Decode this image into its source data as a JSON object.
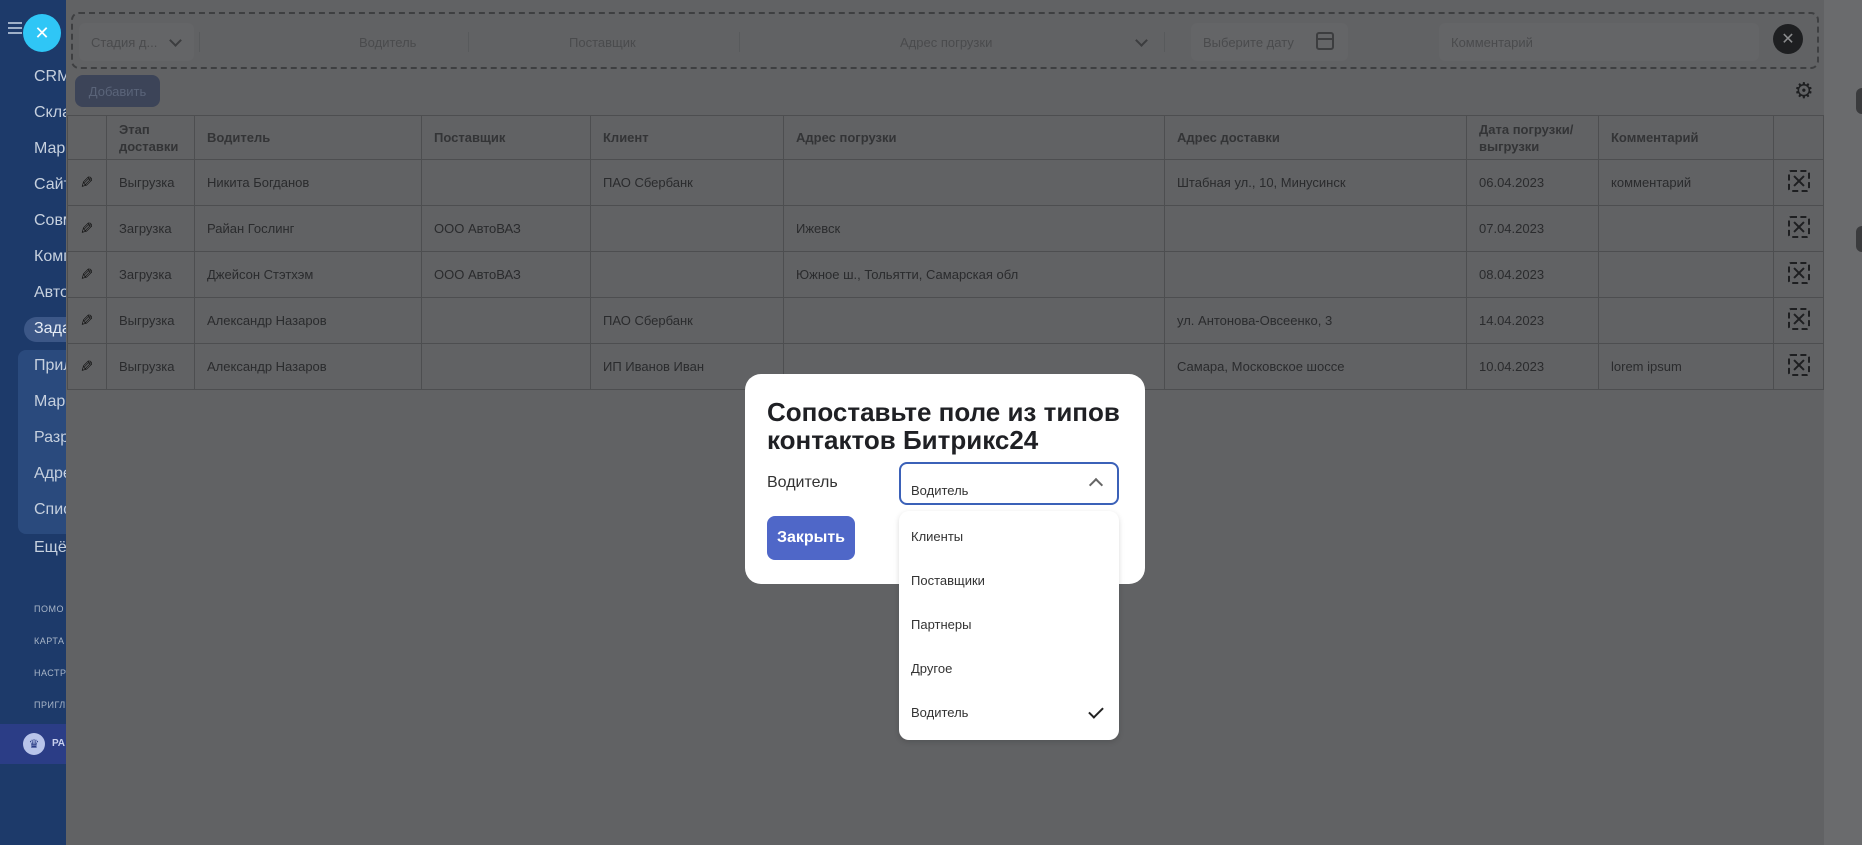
{
  "sidebar": {
    "menu": [
      "CRM",
      "Скла",
      "Мар",
      "Сайт",
      "Совм",
      "Комп",
      "Авто",
      "Зада",
      "Прил",
      "Мар",
      "Разр",
      "Адре",
      "Спис",
      "Ещё"
    ],
    "small": [
      "ПОМО",
      "КАРТА",
      "НАСТР",
      "ПРИГЛ"
    ],
    "crown_text": "РА"
  },
  "filters": {
    "stage": "Стадия д...",
    "driver": "Водитель",
    "supplier": "Поставщик",
    "load_address": "Адрес погрузки",
    "date": "Выберите дату",
    "comment": "Комментарий"
  },
  "toolbar": {
    "add_label": "Добавить"
  },
  "table": {
    "headers": [
      "Этап доставки",
      "Водитель",
      "Поставщик",
      "Клиент",
      "Адрес погрузки",
      "Адрес доставки",
      "Дата погрузки/ выгрузки",
      "Комментарий"
    ],
    "rows": [
      [
        "Выгрузка",
        "Никита Богданов",
        "",
        "ПАО Сбербанк",
        "",
        "Штабная ул., 10, Минусинск",
        "06.04.2023",
        "комментарий"
      ],
      [
        "Загрузка",
        "Райан Гослинг",
        "ООО АвтоВАЗ",
        "",
        "Ижевск",
        "",
        "07.04.2023",
        ""
      ],
      [
        "Загрузка",
        "Джейсон Стэтхэм",
        "ООО АвтоВАЗ",
        "",
        "Южное ш., Тольятти, Самарская обл",
        "",
        "08.04.2023",
        ""
      ],
      [
        "Выгрузка",
        "Александр Назаров",
        "",
        "ПАО Сбербанк",
        "",
        "ул. Антонова-Овсеенко, 3",
        "14.04.2023",
        ""
      ],
      [
        "Выгрузка",
        "Александр Назаров",
        "",
        "ИП Иванов Иван",
        "",
        "Самара, Московское шоссе",
        "10.04.2023",
        "lorem ipsum"
      ]
    ]
  },
  "modal": {
    "title": "Сопоставьте поле из типов контактов Битрикс24",
    "field_label": "Водитель",
    "selected_value": "Водитель",
    "close_label": "Закрыть",
    "options": [
      "Клиенты",
      "Поставщики",
      "Партнеры",
      "Другое",
      "Водитель"
    ],
    "checked_option": "Водитель"
  }
}
